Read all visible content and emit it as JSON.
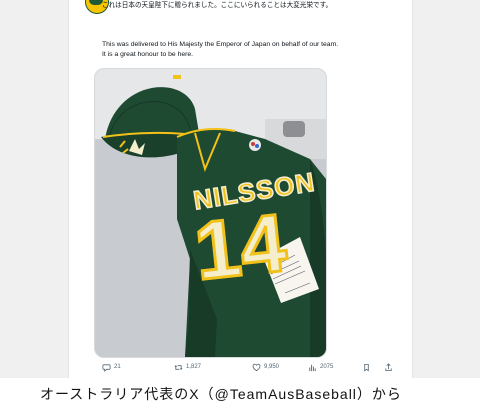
{
  "post": {
    "text_jp": "これは日本の天皇陛下に贈られました。ここにいられることは大変光栄です。",
    "text_en_line1": "This was delivered to His Majesty the Emperor of Japan on behalf of our team.",
    "text_en_line2": "It is a great honour to be here."
  },
  "jersey": {
    "name": "NILSSON",
    "number": "14"
  },
  "actions": {
    "replies": "21",
    "reposts": "1,827",
    "likes": "9,950",
    "views": "2075"
  },
  "caption": "オーストラリア代表のX（@TeamAusBaseball）から",
  "colors": {
    "green": "#1f4a32",
    "gold": "#f2c21a",
    "cream": "#f4eecd",
    "text_secondary": "#536471"
  }
}
